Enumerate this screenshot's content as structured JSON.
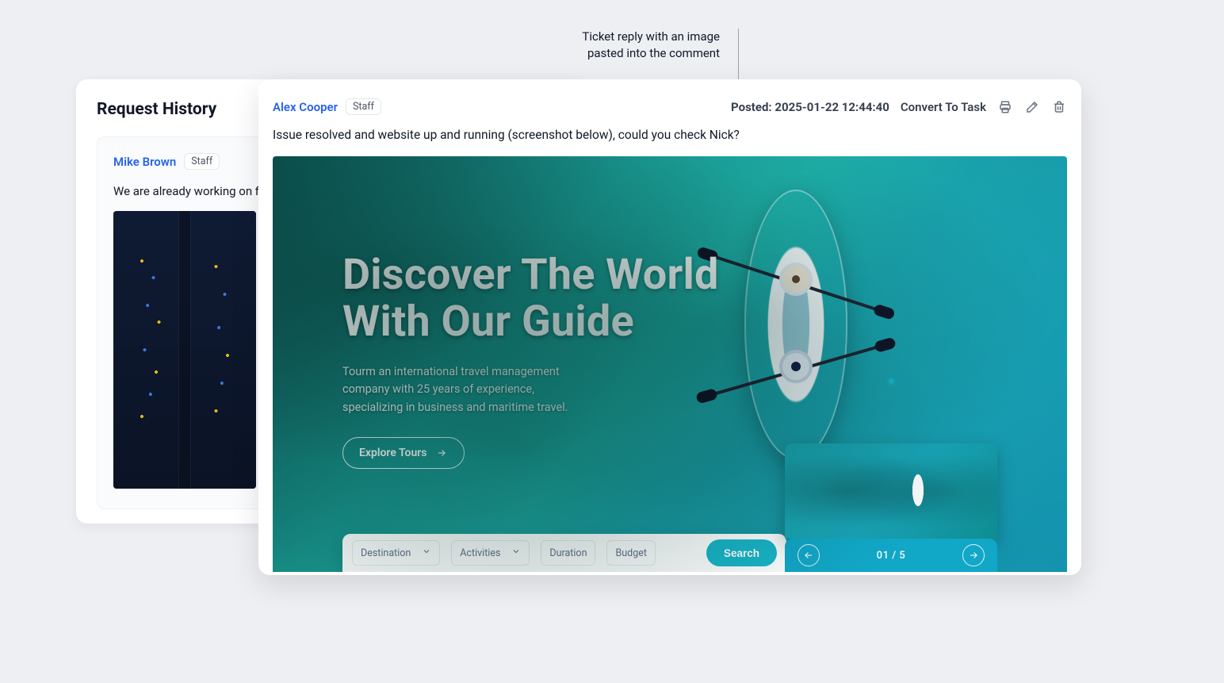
{
  "annotation": {
    "line1": "Ticket reply with an image",
    "line2": "pasted into the comment"
  },
  "back": {
    "title": "Request History",
    "author": "Mike Brown",
    "badge": "Staff",
    "body": "We are already working on fixing..."
  },
  "front": {
    "author": "Alex Cooper",
    "badge": "Staff",
    "posted_label": "Posted:",
    "posted_value": "2025-01-22 12:44:40",
    "convert_label": "Convert To Task",
    "body": "Issue resolved and website up and running (screenshot below), could you check Nick?"
  },
  "hero": {
    "title_l1": "Discover The World",
    "title_l2": "With Our Guide",
    "desc": "Tourm an international travel management company with 25 years of experience, specializing in business and maritime travel.",
    "cta": "Explore Tours",
    "search": {
      "destination": "Destination",
      "activities": "Activities",
      "duration": "Duration",
      "budget": "Budget",
      "button": "Search"
    },
    "pager": "01 / 5"
  }
}
